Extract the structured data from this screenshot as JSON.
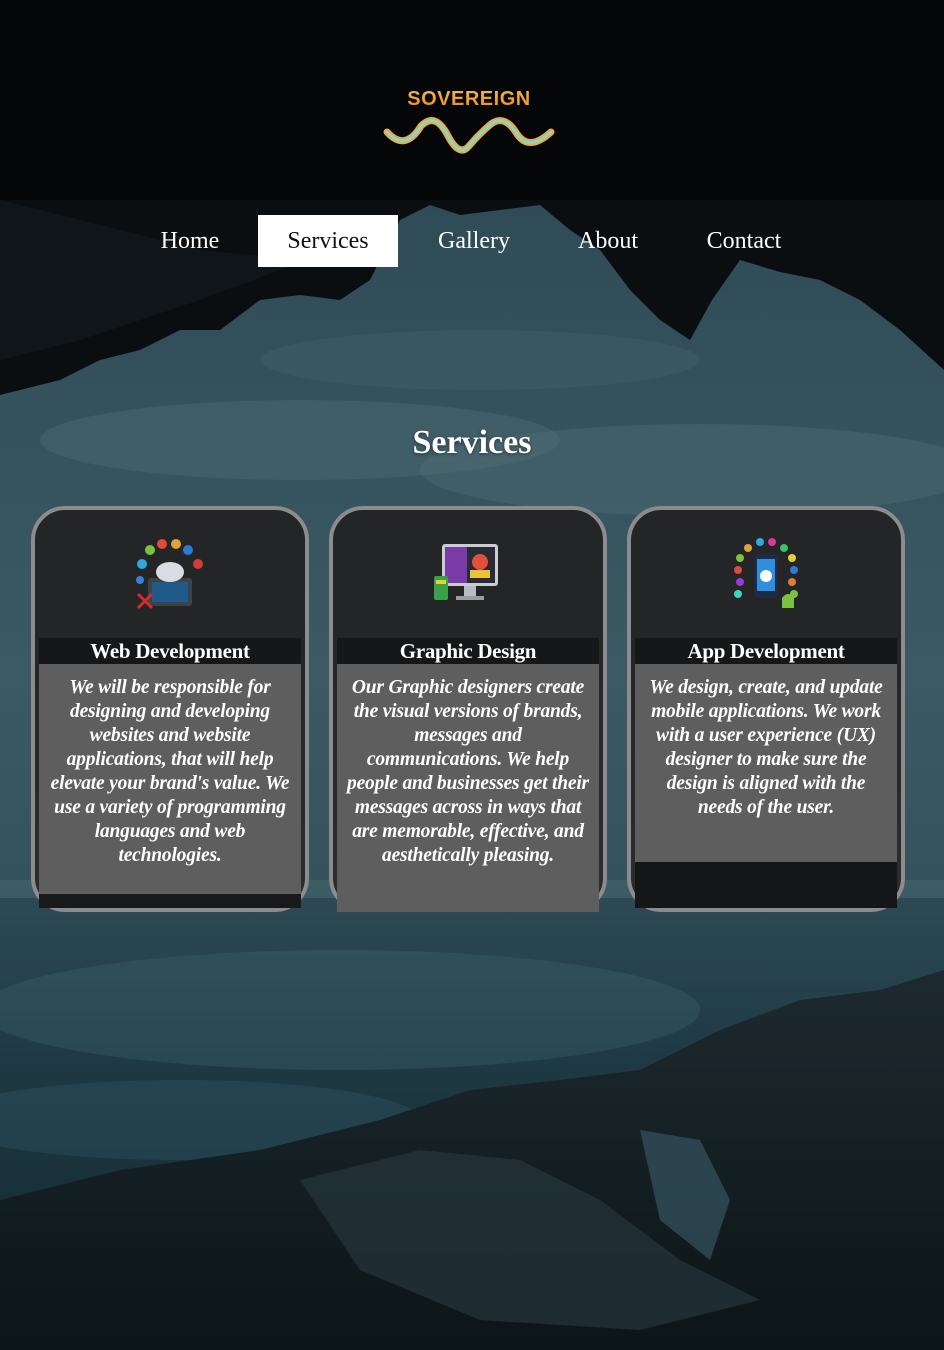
{
  "brand": {
    "name": "SOVEREIGN",
    "accent": "#f5a623",
    "wave_color": "#7fd4d0"
  },
  "nav": {
    "items": [
      {
        "label": "Home"
      },
      {
        "label": "Services"
      },
      {
        "label": "Gallery"
      },
      {
        "label": "About"
      },
      {
        "label": "Contact"
      }
    ],
    "active": "Services"
  },
  "main": {
    "title": "Services",
    "cards": [
      {
        "icon": "web-development-icon",
        "title": "Web Development",
        "body": "We will be responsible for designing and developing websites and website applications, that will help elevate your brand's value. We use a variety of programming languages and web technologies."
      },
      {
        "icon": "graphic-design-icon",
        "title": "Graphic Design",
        "body": "Our Graphic designers create the visual versions of brands, messages and communications. We help people and businesses get their messages across in ways that are memorable, effective, and aesthetically pleasing."
      },
      {
        "icon": "app-development-icon",
        "title": "App Development",
        "body": "We design, create, and update mobile applications. We work with a user experience (UX) designer to make sure the design is aligned with the needs of the user."
      }
    ]
  }
}
